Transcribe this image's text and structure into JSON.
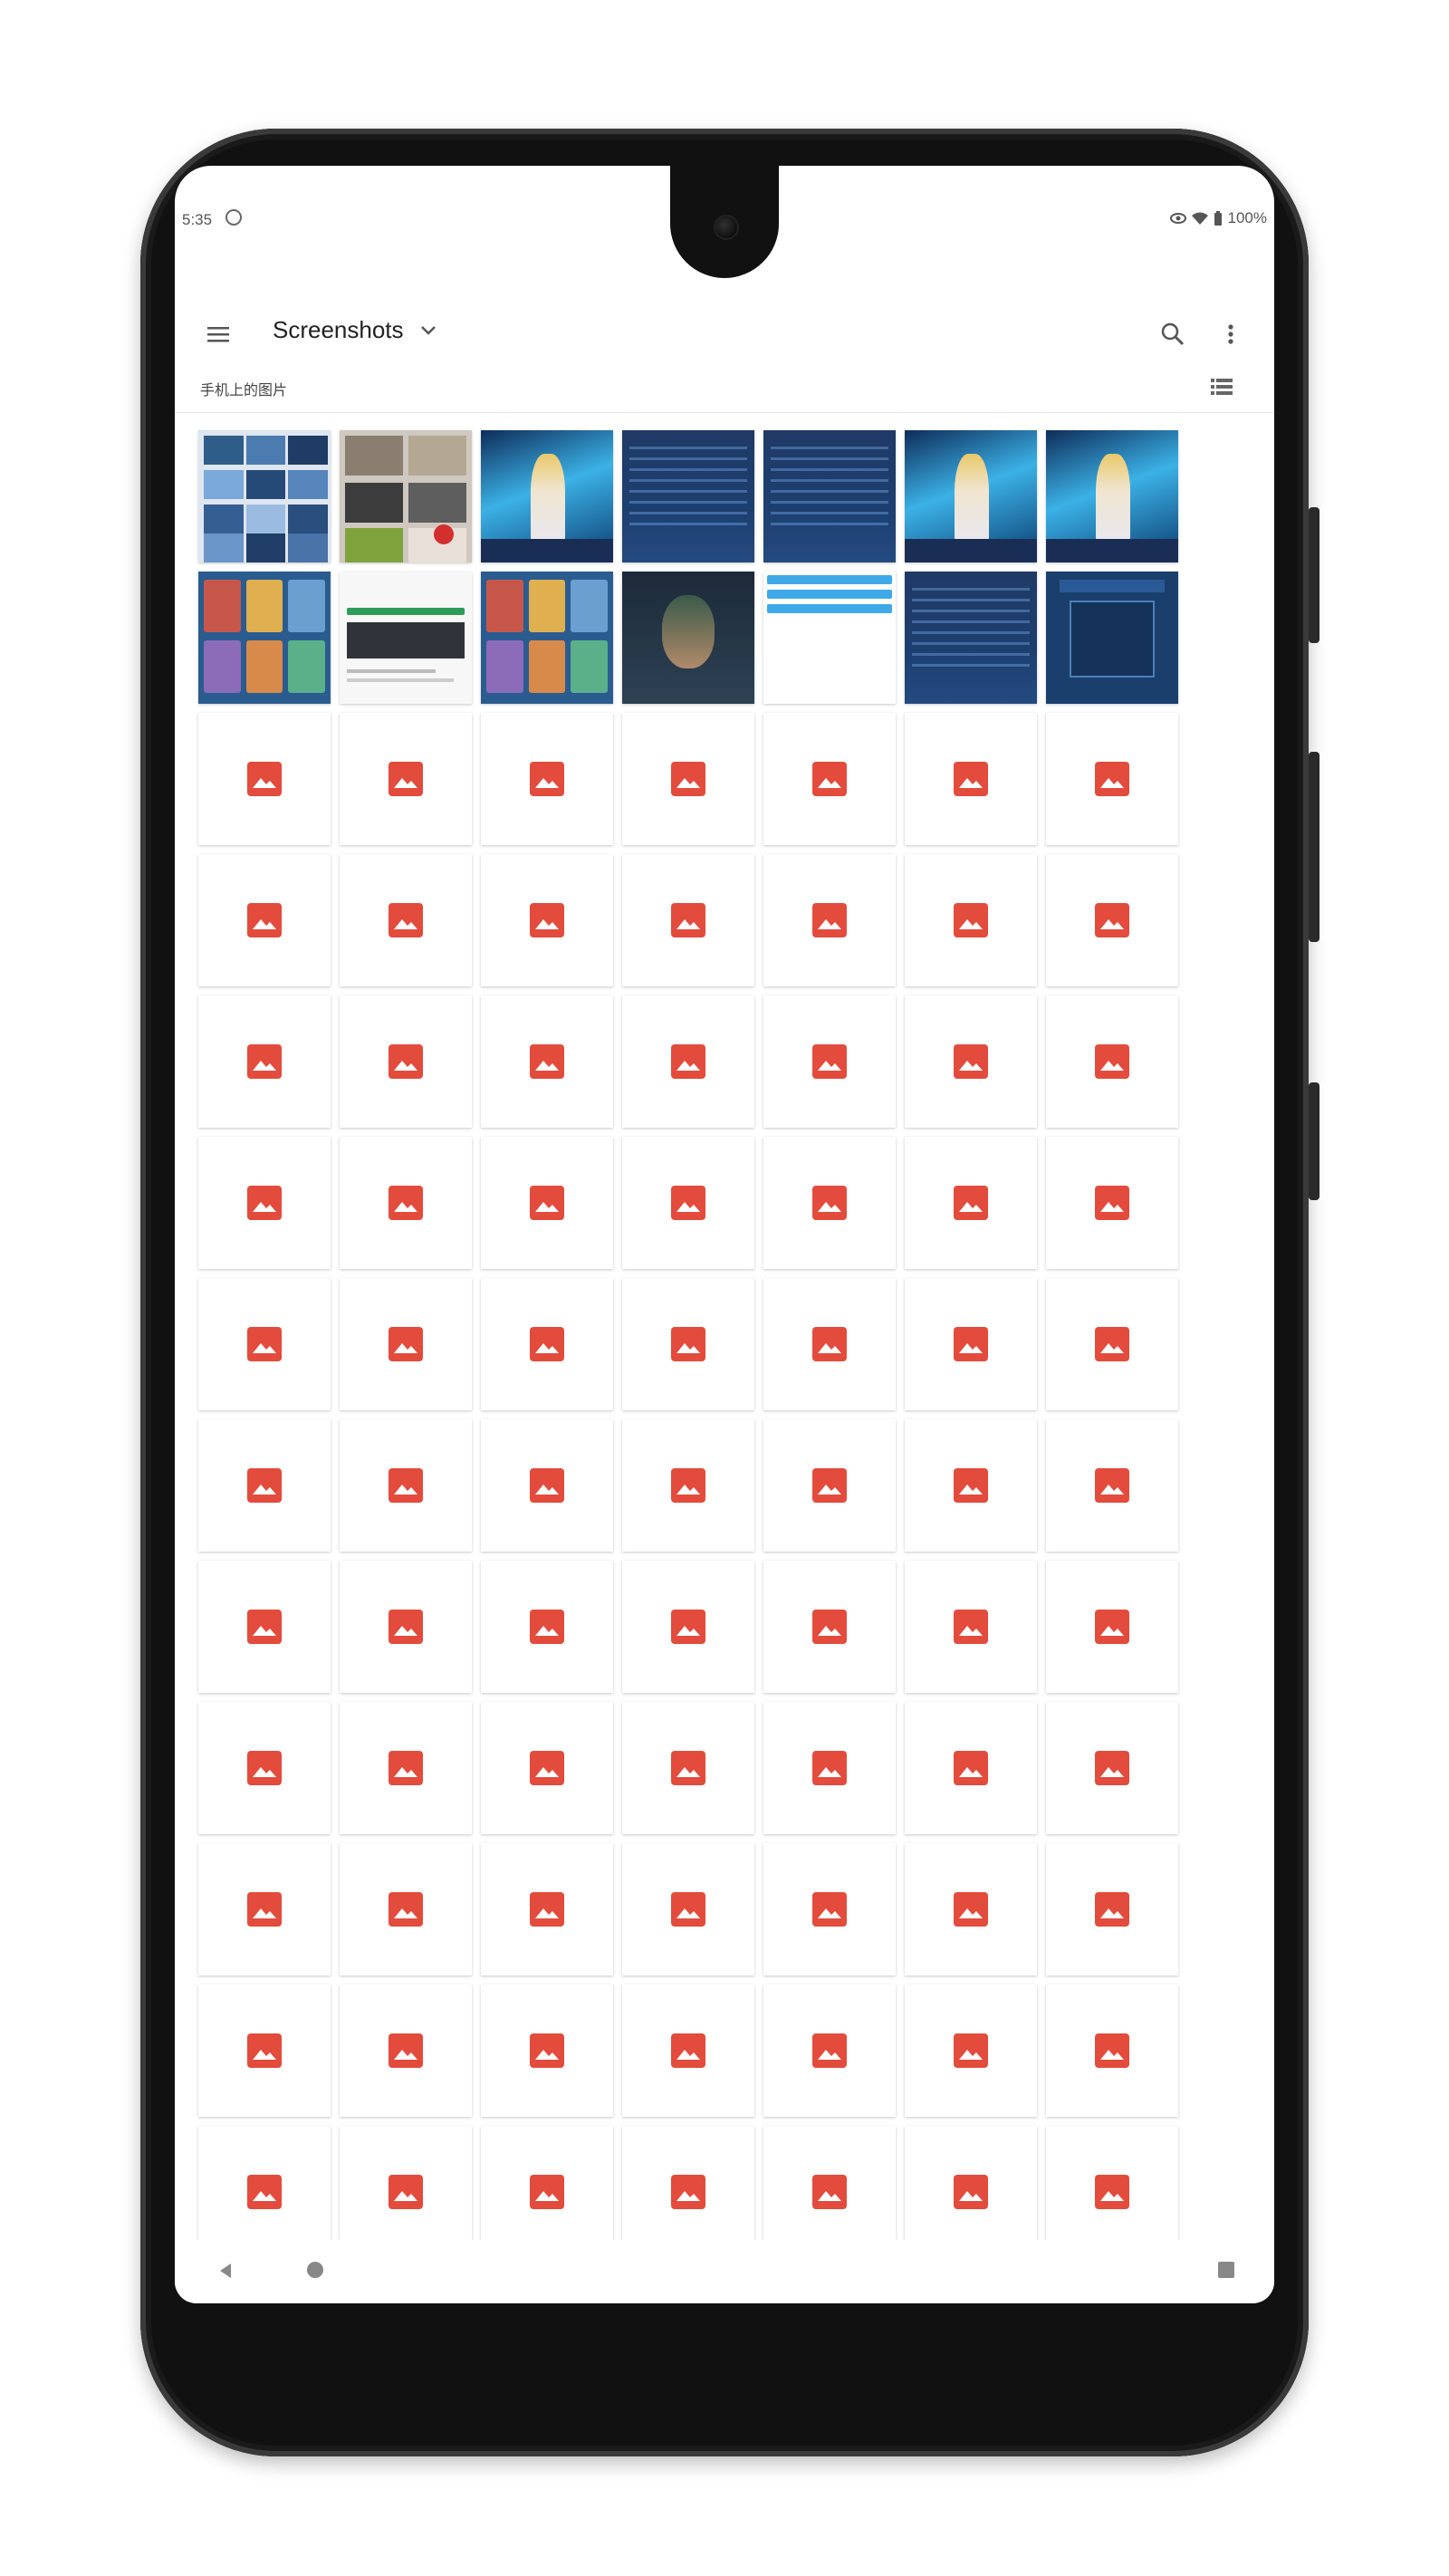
{
  "status_bar": {
    "time": "5:35",
    "battery": "100%"
  },
  "app_bar": {
    "title": "Screenshots",
    "icons": [
      "menu-icon",
      "chevron-down-icon",
      "search-icon",
      "more-vert-icon"
    ]
  },
  "section": {
    "title": "手机上的图片",
    "view_toggle_icon": "list-view-icon"
  },
  "grid": {
    "columns": 7,
    "thumbnail_rows": 2,
    "placeholder_rows": 11,
    "placeholder_icon": "image-icon",
    "placeholder_color": "#e34b3c",
    "thumbnails": [
      {
        "style": "collage"
      },
      {
        "style": "collage-dark"
      },
      {
        "style": "anime"
      },
      {
        "style": "blue"
      },
      {
        "style": "blue"
      },
      {
        "style": "anime"
      },
      {
        "style": "anime"
      },
      {
        "style": "cards"
      },
      {
        "style": "store"
      },
      {
        "style": "cards"
      },
      {
        "style": "dark"
      },
      {
        "style": "white"
      },
      {
        "style": "blue"
      },
      {
        "style": "dialog"
      }
    ]
  },
  "nav_bar": {
    "icons": [
      "back-icon",
      "home-icon",
      "recents-icon"
    ]
  },
  "colors": {
    "accent_red": "#e34b3c",
    "phone_frame": "#111111",
    "text_primary": "#222222"
  }
}
